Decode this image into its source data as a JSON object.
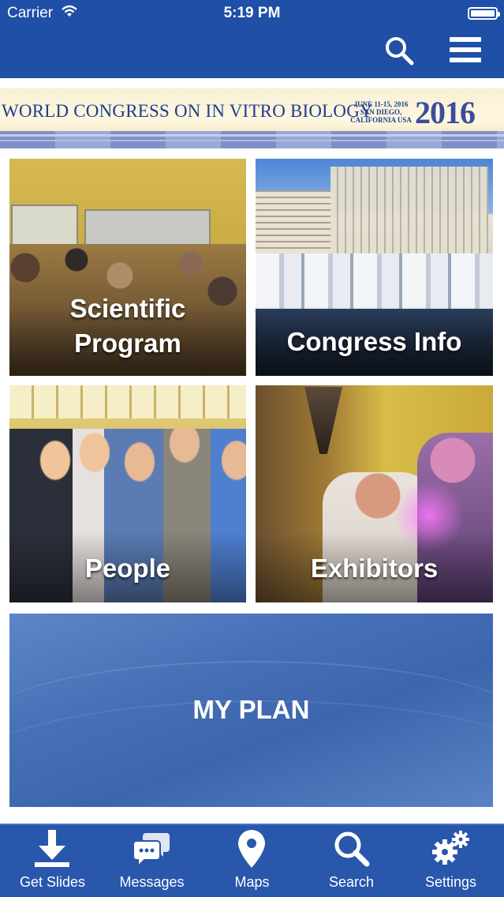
{
  "status_bar": {
    "carrier": "Carrier",
    "time": "5:19 PM"
  },
  "header": {
    "search_icon": "search-icon",
    "menu_icon": "hamburger-menu-icon"
  },
  "banner": {
    "title": "WORLD CONGRESS ON IN VITRO BIOLOGY",
    "dates_line1": "JUNE 11-15, 2016",
    "dates_line2": "SAN DIEGO,",
    "dates_line3": "CALIFORNIA USA",
    "year": "2016"
  },
  "tiles": {
    "scientific_line1": "Scientific",
    "scientific_line2": "Program",
    "congress_info": "Congress Info",
    "people": "People",
    "exhibitors": "Exhibitors",
    "my_plan": "MY PLAN"
  },
  "tabbar": {
    "items": [
      {
        "label": "Get Slides",
        "icon": "download-icon"
      },
      {
        "label": "Messages",
        "icon": "chat-bubbles-icon"
      },
      {
        "label": "Maps",
        "icon": "map-pin-icon"
      },
      {
        "label": "Search",
        "icon": "search-icon"
      },
      {
        "label": "Settings",
        "icon": "gears-icon"
      }
    ]
  },
  "colors": {
    "brand_blue": "#1f4fa6",
    "tabbar_blue": "#2857ab",
    "plan_blue": "#4670b6"
  }
}
